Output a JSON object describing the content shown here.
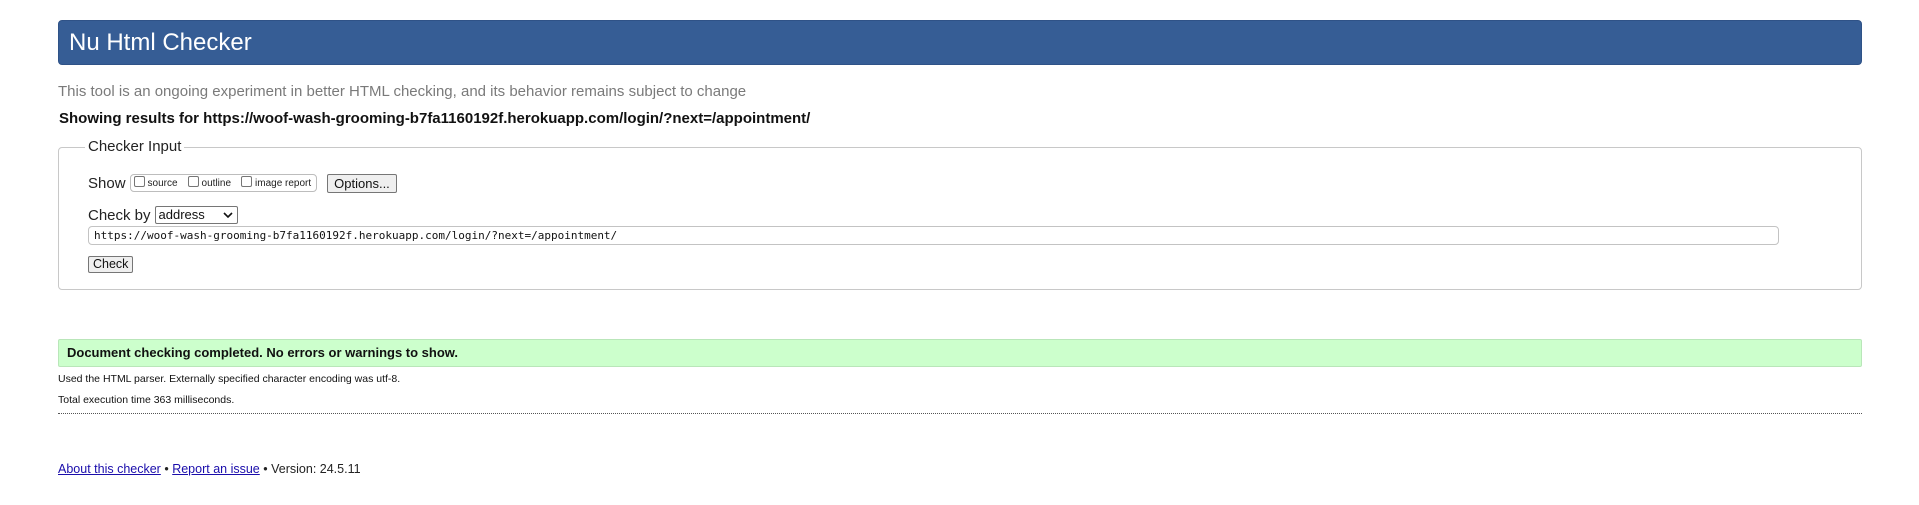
{
  "header": {
    "title": "Nu Html Checker"
  },
  "subtitle": "This tool is an ongoing experiment in better HTML checking, and its behavior remains subject to change",
  "showing_results": "Showing results for https://woof-wash-grooming-b7fa1160192f.herokuapp.com/login/?next=/appointment/",
  "checker_input": {
    "legend": "Checker Input",
    "show_label": "Show",
    "checkboxes": [
      {
        "label": "source",
        "checked": false
      },
      {
        "label": "outline",
        "checked": false
      },
      {
        "label": "image report",
        "checked": false
      }
    ],
    "options_button": "Options...",
    "check_by_label": "Check by",
    "check_by_value": "address",
    "url_value": "https://woof-wash-grooming-b7fa1160192f.herokuapp.com/login/?next=/appointment/",
    "check_button": "Check"
  },
  "result": {
    "success_message": "Document checking completed. No errors or warnings to show.",
    "parser_info": "Used the HTML parser. Externally specified character encoding was utf-8.",
    "execution_time": "Total execution time 363 milliseconds."
  },
  "footer": {
    "about_link": "About this checker",
    "separator": "•",
    "report_link": "Report an issue",
    "version": "Version: 24.5.11"
  },
  "colors": {
    "header_bg": "#365d95",
    "success_bg": "#ccffcc",
    "link": "#1a0dab"
  }
}
